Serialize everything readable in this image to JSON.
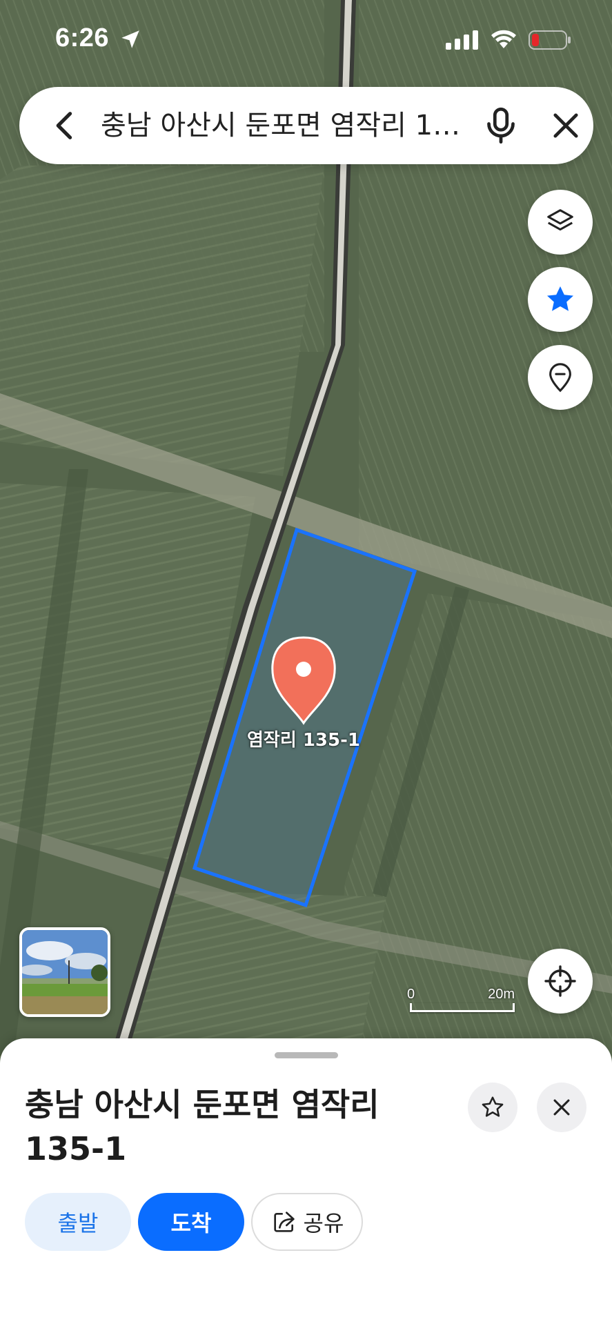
{
  "status_bar": {
    "time": "6:26",
    "icons": [
      "location-arrow-icon",
      "cellular-signal-icon",
      "wifi-icon",
      "battery-low-icon"
    ]
  },
  "search": {
    "query": "충남 아산시 둔포면 염작리 13...",
    "icons": [
      "back-icon",
      "microphone-icon",
      "close-icon"
    ]
  },
  "map": {
    "pin_label": "염작리 135-1",
    "scale_start": "0",
    "scale_end": "20m",
    "controls": [
      "layers-icon",
      "star-icon",
      "location-pin-icon",
      "crosshair-icon"
    ],
    "colors": {
      "parcel_outline": "#1a73ff",
      "pin": "#f2705a"
    }
  },
  "sheet": {
    "title": "충남 아산시 둔포면 염작리 135-1",
    "start_label": "출발",
    "destination_label": "도착",
    "share_label": "공유"
  },
  "colors": {
    "accent": "#0a6dff",
    "accent_soft": "#e6f0fc"
  }
}
